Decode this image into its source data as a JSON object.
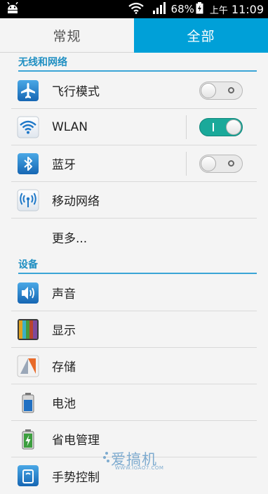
{
  "status_bar": {
    "battery": "68%",
    "ampm": "上午",
    "time": "11:09"
  },
  "tabs": [
    {
      "label": "常规",
      "active": false
    },
    {
      "label": "全部",
      "active": true
    }
  ],
  "sections": {
    "wireless": {
      "header": "无线和网络",
      "items": [
        {
          "label": "飞行模式",
          "icon": "airplane-icon",
          "toggle": "off"
        },
        {
          "label": "WLAN",
          "icon": "wifi-icon",
          "toggle": "on"
        },
        {
          "label": "蓝牙",
          "icon": "bluetooth-icon",
          "toggle": "off"
        },
        {
          "label": "移动网络",
          "icon": "mobile-network-icon"
        },
        {
          "label": "更多..."
        }
      ]
    },
    "device": {
      "header": "设备",
      "items": [
        {
          "label": "声音",
          "icon": "sound-icon"
        },
        {
          "label": "显示",
          "icon": "display-icon"
        },
        {
          "label": "存储",
          "icon": "storage-icon"
        },
        {
          "label": "电池",
          "icon": "battery-icon"
        },
        {
          "label": "省电管理",
          "icon": "power-saving-icon"
        },
        {
          "label": "手势控制",
          "icon": "gesture-icon"
        }
      ]
    }
  },
  "watermark": {
    "text": "爱搞机",
    "url": "WWW.IGAO7.COM"
  },
  "colors": {
    "accent": "#00a0d8",
    "section_header": "#1f8fc2",
    "toggle_on": "#1aa99a"
  }
}
